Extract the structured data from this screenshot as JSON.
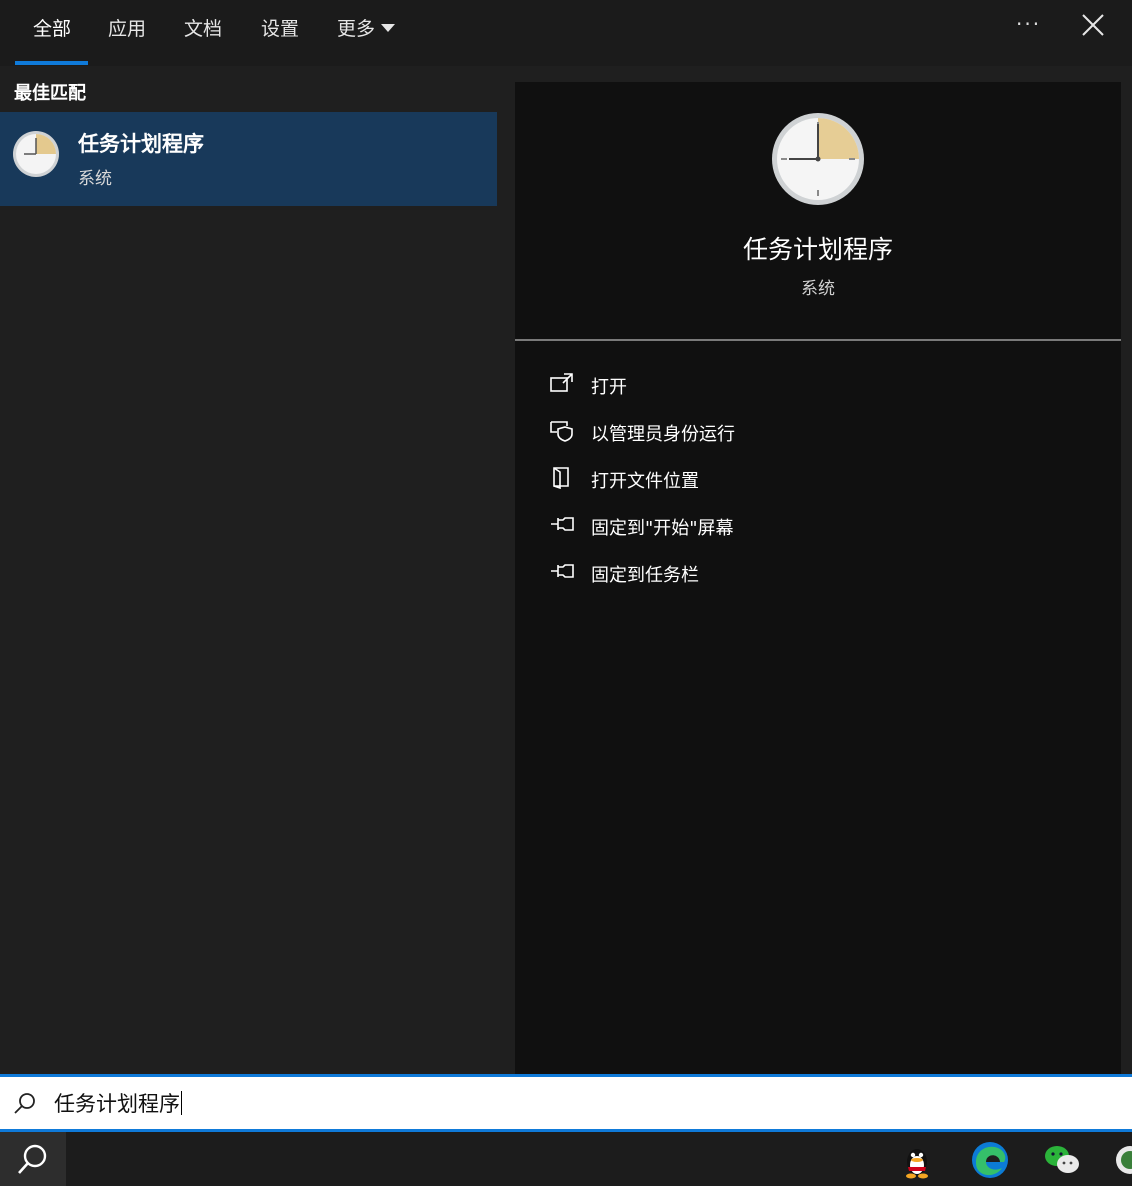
{
  "tabs": [
    {
      "label": "全部",
      "active": true
    },
    {
      "label": "应用"
    },
    {
      "label": "文档"
    },
    {
      "label": "设置"
    },
    {
      "label": "更多"
    }
  ],
  "window_controls": {
    "more_label": "···",
    "close_icon": "close-icon"
  },
  "left": {
    "section_label": "最佳匹配",
    "result": {
      "title": "任务计划程序",
      "subtitle": "系统",
      "icon": "clock-icon"
    }
  },
  "right": {
    "title": "任务计划程序",
    "subtitle": "系统",
    "actions": [
      {
        "label": "打开",
        "icon": "open-icon"
      },
      {
        "label": "以管理员身份运行",
        "icon": "run-as-admin-icon"
      },
      {
        "label": "打开文件位置",
        "icon": "file-location-icon"
      },
      {
        "label": "固定到\"开始\"屏幕",
        "icon": "pin-icon"
      },
      {
        "label": "固定到任务栏",
        "icon": "pin-icon"
      }
    ]
  },
  "search": {
    "value": "任务计划程序",
    "icon": "search-icon"
  },
  "taskbar": {
    "apps": [
      "qq-icon",
      "edge-icon",
      "wechat-icon",
      "app-icon"
    ]
  },
  "colors": {
    "accent": "#0f7ad9",
    "selected": "#18395a",
    "panel": "#101010",
    "background": "#1f1f1f"
  }
}
